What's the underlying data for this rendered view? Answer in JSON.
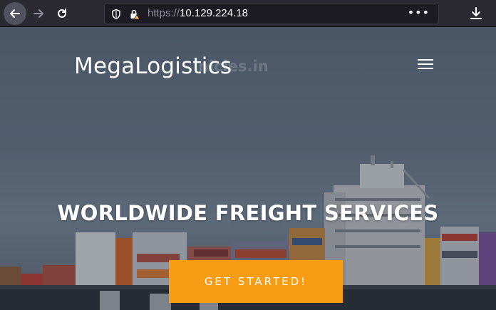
{
  "browser": {
    "url_scheme": "https://",
    "url_host": "10.129.224.18",
    "menu_dots": "•••"
  },
  "site": {
    "logo": "MegaLogistics",
    "watermark": "nicles.in",
    "hero_title": "WORLDWIDE FREIGHT SERVICES",
    "cta_label": "GET STARTED!"
  },
  "colors": {
    "accent": "#f89d13",
    "toolbar": "#2b2a33",
    "urlbar": "#1c1b22"
  }
}
